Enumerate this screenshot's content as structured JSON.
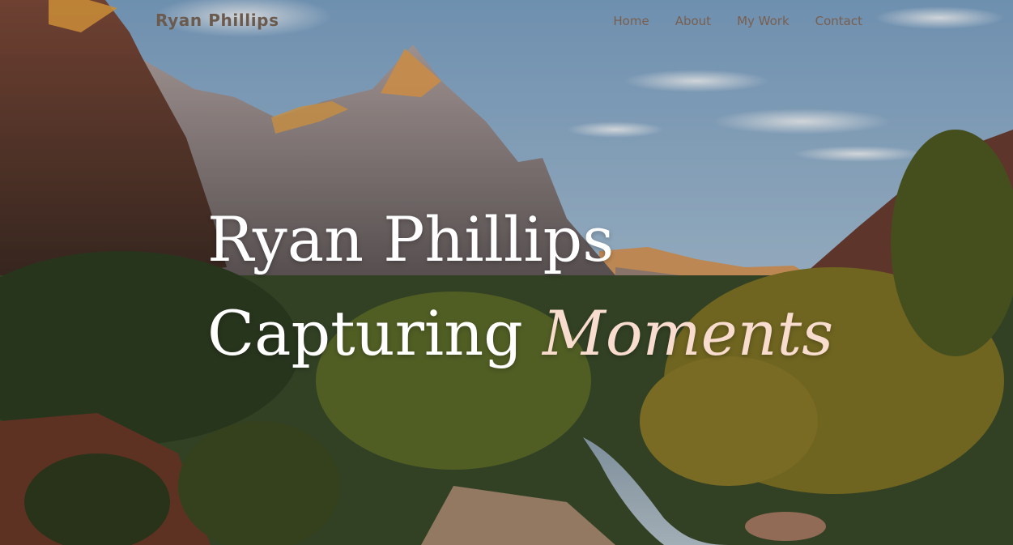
{
  "nav": {
    "brand": "Ryan Phillips",
    "links": [
      "Home",
      "About",
      "My Work",
      "Contact"
    ]
  },
  "hero": {
    "line1": "Ryan Phillips",
    "line2_plain": "Capturing",
    "line2_accent": "Moments",
    "background": "canyon-landscape-photo"
  },
  "colors": {
    "nav_text": "#7a5f4e",
    "headline": "#ffffff",
    "accent": "#f8dccd"
  }
}
